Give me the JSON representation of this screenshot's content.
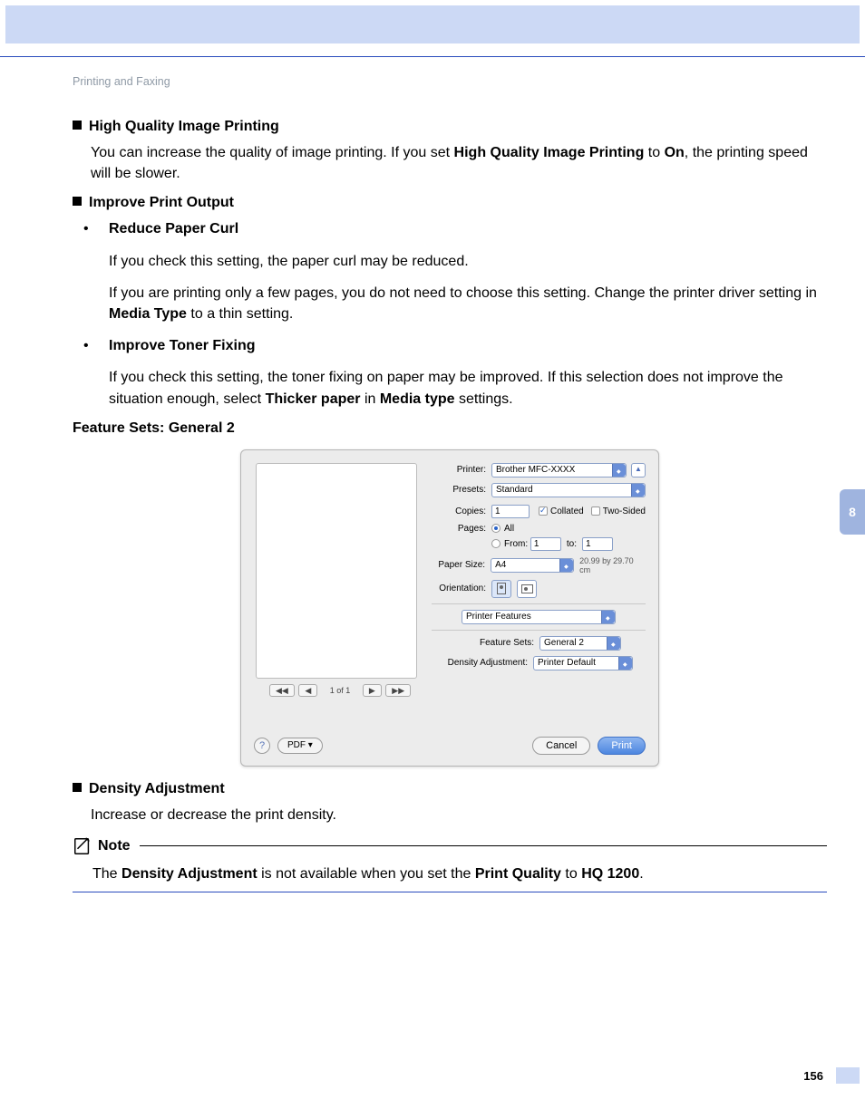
{
  "header": {
    "breadcrumb": "Printing and Faxing"
  },
  "side_tab": "8",
  "page_number": "156",
  "sections": {
    "hqip": {
      "title": "High Quality Image Printing",
      "p1a": "You can increase the quality of image printing. If you set ",
      "p1b": "High Quality Image Printing",
      "p1c": " to ",
      "p1d": "On",
      "p1e": ", the printing speed will be slower."
    },
    "ipo": {
      "title": "Improve Print Output",
      "rpc": {
        "title": "Reduce Paper Curl",
        "p1": "If you check this setting, the paper curl may be reduced.",
        "p2a": "If you are printing only a few pages, you do not need to choose this setting. Change the printer driver setting in ",
        "p2b": "Media Type",
        "p2c": " to a thin setting."
      },
      "itf": {
        "title": "Improve Toner Fixing",
        "p1a": "If you check this setting, the toner fixing on paper may be improved. If this selection does not improve the situation enough, select ",
        "p1b": "Thicker paper",
        "p1c": " in ",
        "p1d": "Media type",
        "p1e": " settings."
      }
    },
    "fs": {
      "title": "Feature Sets: General 2"
    },
    "da": {
      "title": "Density Adjustment",
      "p1": "Increase or decrease the print density."
    },
    "note": {
      "title": "Note",
      "b1a": "The ",
      "b1b": "Density Adjustment",
      "b1c": " is not available when you set the ",
      "b1d": "Print Quality",
      "b1e": " to ",
      "b1f": "HQ 1200",
      "b1g": "."
    }
  },
  "dialog": {
    "labels": {
      "printer": "Printer:",
      "presets": "Presets:",
      "copies": "Copies:",
      "pages": "Pages:",
      "paper_size": "Paper Size:",
      "orientation": "Orientation:",
      "feature_sets": "Feature Sets:",
      "density_adjustment": "Density Adjustment:",
      "from": "From:",
      "to": "to:",
      "all": "All",
      "collated": "Collated",
      "two_sided": "Two-Sided"
    },
    "values": {
      "printer": "Brother MFC-XXXX",
      "presets": "Standard",
      "copies": "1",
      "from": "1",
      "to": "1",
      "paper_size": "A4",
      "paper_dims": "20.99 by 29.70 cm",
      "section_dropdown": "Printer Features",
      "feature_sets": "General 2",
      "density_adjustment": "Printer Default",
      "page_counter": "1 of 1"
    },
    "buttons": {
      "help": "?",
      "pdf": "PDF ▾",
      "cancel": "Cancel",
      "print": "Print",
      "expand": "▲"
    }
  }
}
